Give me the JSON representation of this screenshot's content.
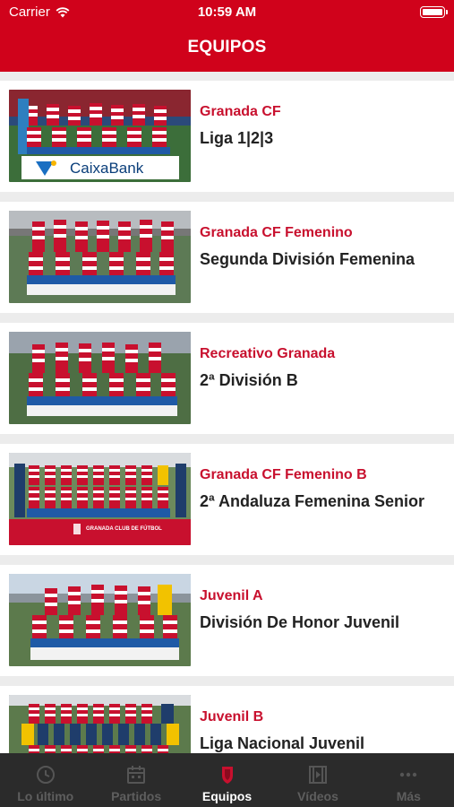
{
  "status_bar": {
    "carrier": "Carrier",
    "time": "10:59 AM"
  },
  "header": {
    "title": "EQUIPOS"
  },
  "teams": [
    {
      "name": "Granada CF",
      "league": "Liga 1|2|3",
      "banner": "CaixaBank"
    },
    {
      "name": "Granada CF Femenino",
      "league": "Segunda División Femenina"
    },
    {
      "name": "Recreativo Granada",
      "league": "2ª División B"
    },
    {
      "name": "Granada CF Femenino B",
      "league": "2ª Andaluza Femenina Senior",
      "banner": "GRANADA CLUB DE FÚTBOL"
    },
    {
      "name": "Juvenil A",
      "league": "División De Honor Juvenil"
    },
    {
      "name": "Juvenil B",
      "league": "Liga Nacional Juvenil"
    }
  ],
  "tabs": [
    {
      "label": "Lo último",
      "icon": "clock-icon",
      "active": false
    },
    {
      "label": "Partidos",
      "icon": "calendar-icon",
      "active": false
    },
    {
      "label": "Equipos",
      "icon": "shield-icon",
      "active": true
    },
    {
      "label": "Vídeos",
      "icon": "film-icon",
      "active": false
    },
    {
      "label": "Más",
      "icon": "more-icon",
      "active": false
    }
  ],
  "colors": {
    "brand_red": "#d0021b",
    "team_name": "#c8102e",
    "tabbar": "#2b2b2b"
  }
}
